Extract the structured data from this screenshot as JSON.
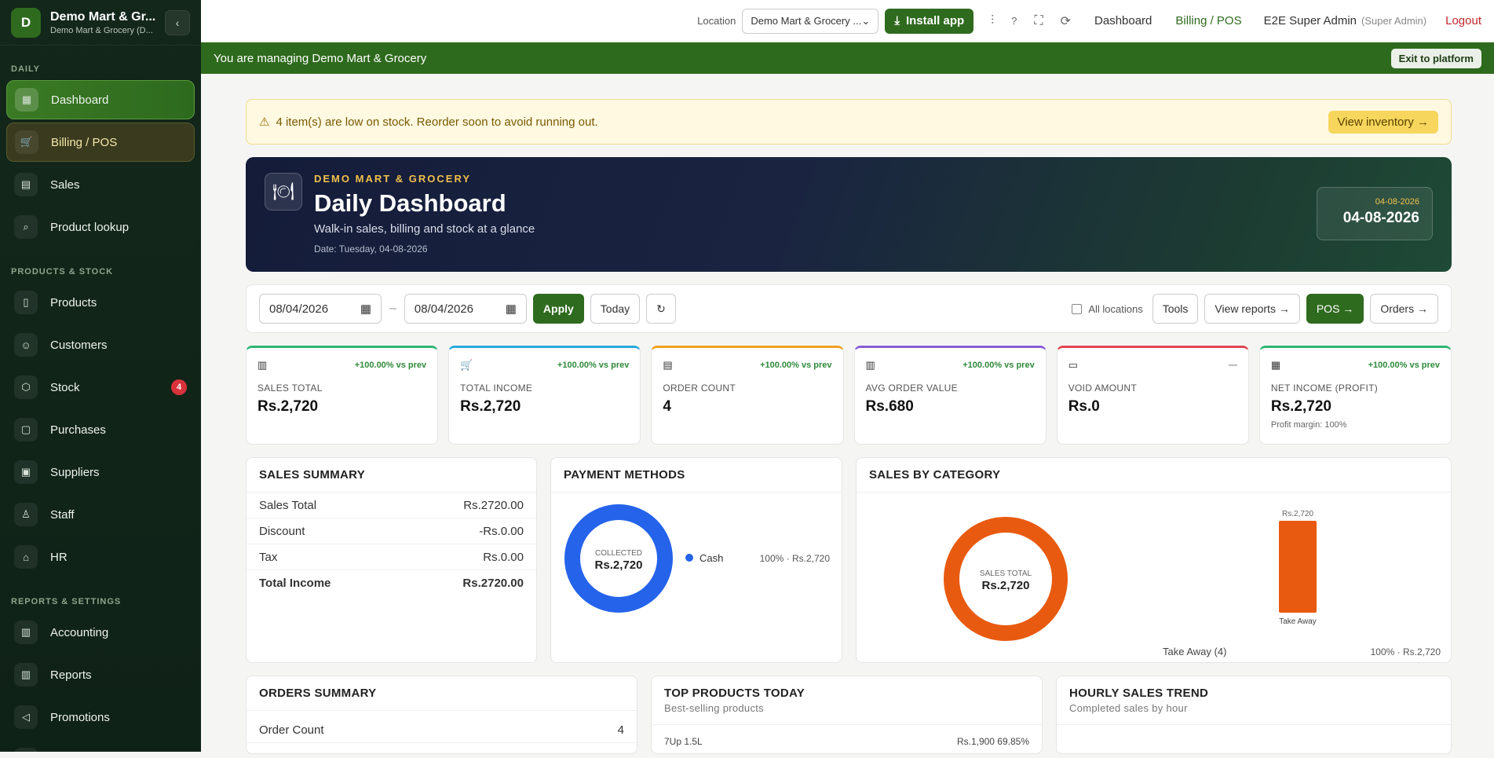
{
  "sidebar": {
    "brand_initial": "D",
    "brand_name": "Demo Mart & Gr...",
    "brand_sub": "Demo Mart & Grocery (D...",
    "sections": [
      {
        "title": "DAILY",
        "items": [
          {
            "label": "Dashboard",
            "icon": "grid-icon"
          },
          {
            "label": "Billing / POS",
            "icon": "cart-icon"
          },
          {
            "label": "Sales",
            "icon": "clipboard-icon"
          },
          {
            "label": "Product lookup",
            "icon": "search-icon"
          }
        ]
      },
      {
        "title": "PRODUCTS & STOCK",
        "items": [
          {
            "label": "Products",
            "icon": "book-icon"
          },
          {
            "label": "Customers",
            "icon": "users-icon"
          },
          {
            "label": "Stock",
            "icon": "box-icon",
            "badge": "4"
          },
          {
            "label": "Purchases",
            "icon": "lock-icon"
          },
          {
            "label": "Suppliers",
            "icon": "truck-icon"
          },
          {
            "label": "Staff",
            "icon": "person-icon"
          },
          {
            "label": "HR",
            "icon": "building-icon"
          }
        ]
      },
      {
        "title": "REPORTS & SETTINGS",
        "items": [
          {
            "label": "Accounting",
            "icon": "bar-chart-icon"
          },
          {
            "label": "Reports",
            "icon": "bar-chart-icon"
          },
          {
            "label": "Promotions",
            "icon": "megaphone-icon"
          }
        ]
      }
    ]
  },
  "topbar": {
    "location_label": "Location",
    "location_value": "Demo Mart & Grocery ...",
    "install_label": "Install app",
    "help": "?",
    "dashboard_link": "Dashboard",
    "billing_link": "Billing / POS",
    "user": "E2E Super Admin",
    "role": "(Super Admin)",
    "logout": "Logout"
  },
  "banner": {
    "text": "You are managing Demo Mart & Grocery",
    "exit": "Exit to platform"
  },
  "alert": {
    "text": "4 item(s) are low on stock. Reorder soon to avoid running out.",
    "button": "View inventory →"
  },
  "hero": {
    "store": "DEMO MART & GROCERY",
    "title": "Daily Dashboard",
    "desc": "Walk-in sales, billing and stock at a glance",
    "date_line": "Date: Tuesday, 04-08-2026",
    "box_small": "04-08-2026",
    "box_big": "04-08-2026"
  },
  "filter": {
    "from": "08/04/2026",
    "to": "08/04/2026",
    "dash": "–",
    "apply": "Apply",
    "today": "Today",
    "refresh": "↻",
    "all_locations": "All locations",
    "tools": "Tools",
    "view_reports": "View reports →",
    "pos": "POS →",
    "orders": "Orders →"
  },
  "kpis": [
    {
      "label": "SALES TOTAL",
      "value": "Rs.2,720",
      "change": "+100.00% vs prev",
      "color": "#2bb673",
      "icon": "bar-chart-icon"
    },
    {
      "label": "TOTAL INCOME",
      "value": "Rs.2,720",
      "change": "+100.00% vs prev",
      "color": "#2aa8d8",
      "icon": "cart-icon"
    },
    {
      "label": "ORDER COUNT",
      "value": "4",
      "change": "+100.00% vs prev",
      "color": "#f0a020",
      "icon": "clipboard-icon"
    },
    {
      "label": "AVG ORDER VALUE",
      "value": "Rs.680",
      "change": "+100.00% vs prev",
      "color": "#8a5cd6",
      "icon": "bar-chart-icon"
    },
    {
      "label": "VOID AMOUNT",
      "value": "Rs.0",
      "change": "—",
      "color": "#e0454f",
      "icon": "chat-icon"
    },
    {
      "label": "NET INCOME (PROFIT)",
      "value": "Rs.2,720",
      "change": "+100.00% vs prev",
      "color": "#2bb673",
      "icon": "grid-icon",
      "note": "Profit margin: 100%"
    }
  ],
  "sales_summary": {
    "title": "SALES SUMMARY",
    "rows": [
      {
        "label": "Sales Total",
        "value": "Rs.2720.00"
      },
      {
        "label": "Discount",
        "value": "-Rs.0.00"
      },
      {
        "label": "Tax",
        "value": "Rs.0.00"
      },
      {
        "label": "Total Income",
        "value": "Rs.2720.00"
      }
    ]
  },
  "payment": {
    "title": "PAYMENT METHODS",
    "center_label": "COLLECTED",
    "center_value": "Rs.2,720",
    "legend_name": "Cash",
    "legend_value": "100% · Rs.2,720",
    "color": "#2563eb"
  },
  "category": {
    "title": "SALES BY CATEGORY",
    "center_label": "SALES TOTAL",
    "center_value": "Rs.2,720",
    "legend_name": "Take Away (4)",
    "legend_value": "100% · Rs.2,720",
    "color": "#e85a10"
  },
  "chart_data": {
    "type": "bar",
    "categories": [
      "Take Away"
    ],
    "values": [
      2720
    ],
    "value_labels": [
      "Rs.2,720"
    ]
  },
  "orders_summary": {
    "title": "ORDERS SUMMARY",
    "row_label": "Order Count",
    "row_value": "4"
  },
  "top_products": {
    "title": "TOP PRODUCTS TODAY",
    "sub": "Best-selling products",
    "row_label": "7Up 1.5L",
    "row_value": "Rs.1,900 69.85%"
  },
  "hourly": {
    "title": "HOURLY SALES TREND",
    "sub": "Completed sales by hour"
  }
}
